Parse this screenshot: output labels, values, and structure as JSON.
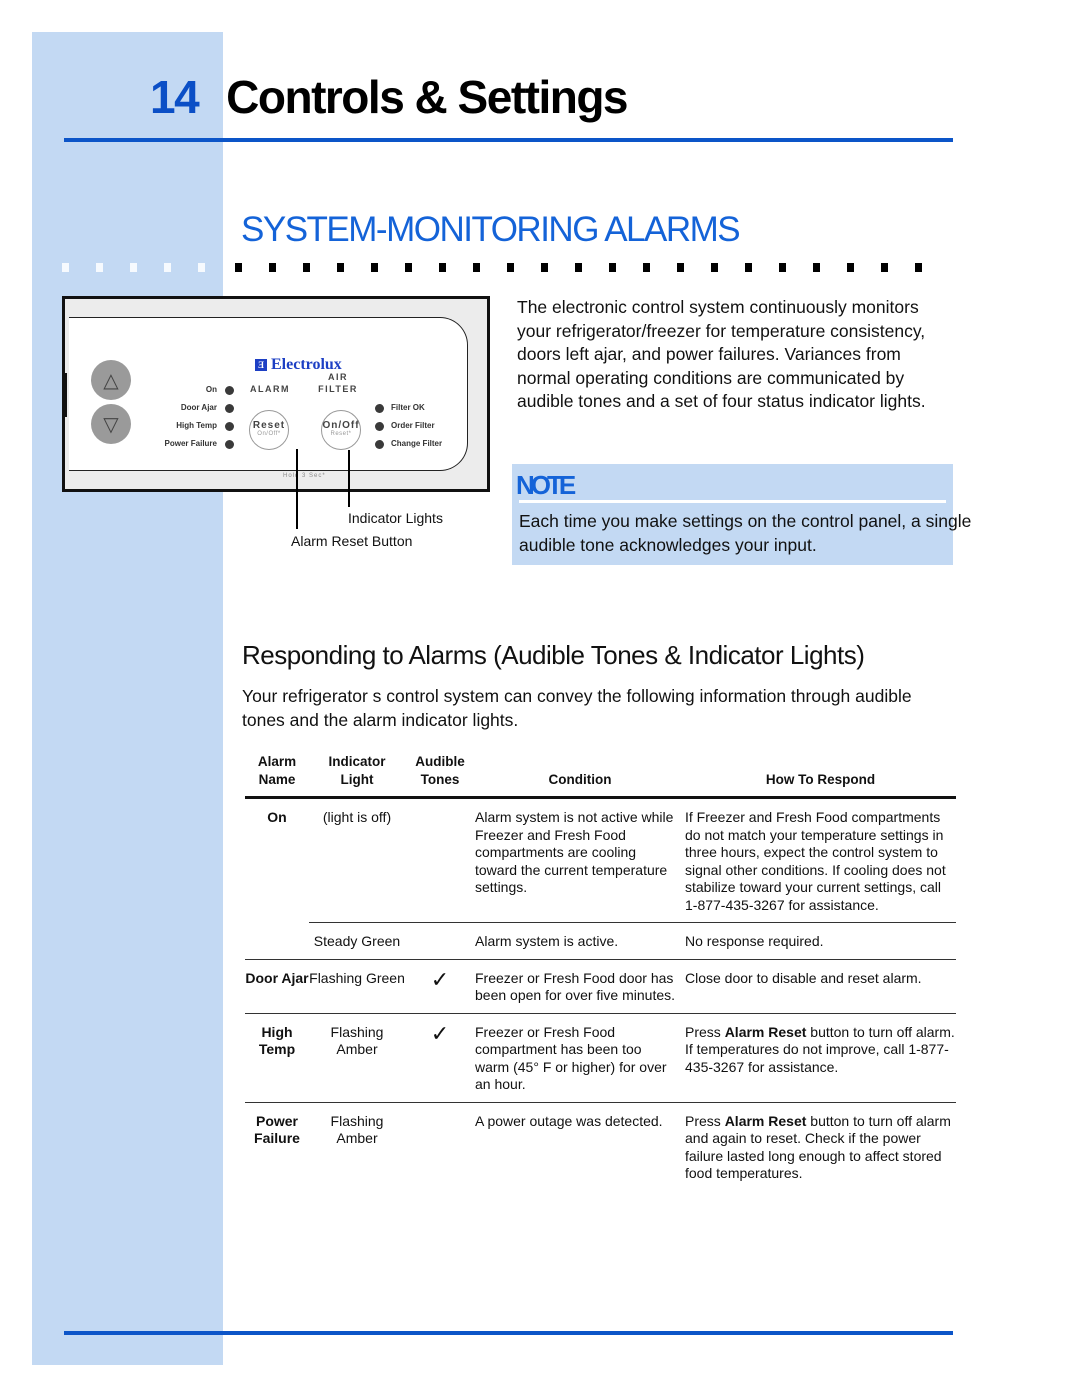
{
  "page": {
    "chapter_number": "14",
    "chapter_title": "Controls & Settings",
    "section_title": "SYSTEM-MONITORING ALARMS",
    "colors": {
      "accent_blue": "#0c55c8",
      "sidebar_blue": "#c3d9f3",
      "heading_blue": "#1463d8"
    }
  },
  "panel": {
    "brand": "Electrolux",
    "brand_icon": "electrolux-logo-icon",
    "up_button_icon": "plus-triangle-icon",
    "down_button_icon": "minus-triangle-icon",
    "alarm_group_label": "ALARM",
    "air_filter_group_label_1": "AIR",
    "air_filter_group_label_2": "FILTER",
    "alarm_lights": [
      "On",
      "Door Ajar",
      "High Temp",
      "Power Failure"
    ],
    "filter_lights": [
      "Filter OK",
      "Order Filter",
      "Change Filter"
    ],
    "reset_button": {
      "main": "Reset",
      "sub": "On/Off*"
    },
    "onoff_button": {
      "main": "On/Off",
      "sub": "Reset*"
    },
    "hold_note": "Hold 3 Sec*",
    "callouts": {
      "indicator_lights": "Indicator Lights",
      "alarm_reset_button": "Alarm Reset Button"
    }
  },
  "intro": "The electronic control system continuously monitors your refrigerator/freezer for temperature consistency, doors left ajar, and power failures. Variances from normal operating conditions are communicated by audible tones and a set of four status indicator lights.",
  "note": {
    "heading": "NOTE",
    "body": "Each time you make settings on the control panel, a single audible tone acknowledges your input."
  },
  "responding": {
    "heading": "Responding to Alarms (Audible Tones & Indicator Lights)",
    "paragraph": "Your refrigerator s control system can convey the following information through audible tones and the alarm indicator lights."
  },
  "table": {
    "headers": {
      "alarm_name_1": "Alarm",
      "alarm_name_2": "Name",
      "indicator_1": "Indicator",
      "indicator_2": "Light",
      "audible_1": "Audible",
      "audible_2": "Tones",
      "condition": "Condition",
      "respond": "How To Respond"
    },
    "check_icon": "✓",
    "rows": [
      {
        "name": "On",
        "light": "(light is off)",
        "tone": "",
        "condition": "Alarm system is not active while Freezer and Fresh Food compartments are cooling toward the current temperature settings.",
        "respond_pre": "If Freezer and Fresh Food compartments do not match your temperature settings in three hours, expect the control system to signal other conditions. If cooling does not stabilize toward your current settings, call 1-877-435-3267 for assistance.",
        "respond_bold": "",
        "respond_post": ""
      },
      {
        "name": "",
        "light": "Steady Green",
        "tone": "",
        "condition": "Alarm system is active.",
        "respond_pre": "No response required.",
        "respond_bold": "",
        "respond_post": ""
      },
      {
        "name": "Door Ajar",
        "light": "Flashing Green",
        "tone": "✓",
        "condition": "Freezer or Fresh Food door has been open for over five minutes.",
        "respond_pre": "Close door to disable and reset alarm.",
        "respond_bold": "",
        "respond_post": ""
      },
      {
        "name": "High Temp",
        "light": "Flashing Amber",
        "tone": "✓",
        "condition": "Freezer or Fresh Food compartment has been too warm (45° F or higher) for over an hour.",
        "respond_pre": "Press ",
        "respond_bold": "Alarm Reset",
        "respond_post": " button to turn off alarm. If temperatures do not improve, call 1-877-435-3267 for assistance."
      },
      {
        "name": "Power Failure",
        "light": "Flashing Amber",
        "tone": "",
        "condition": "A power outage was detected.",
        "respond_pre": "Press ",
        "respond_bold": "Alarm Reset",
        "respond_post": " button to turn off alarm and again to reset. Check if the power failure lasted long enough to affect stored food temperatures."
      }
    ]
  }
}
